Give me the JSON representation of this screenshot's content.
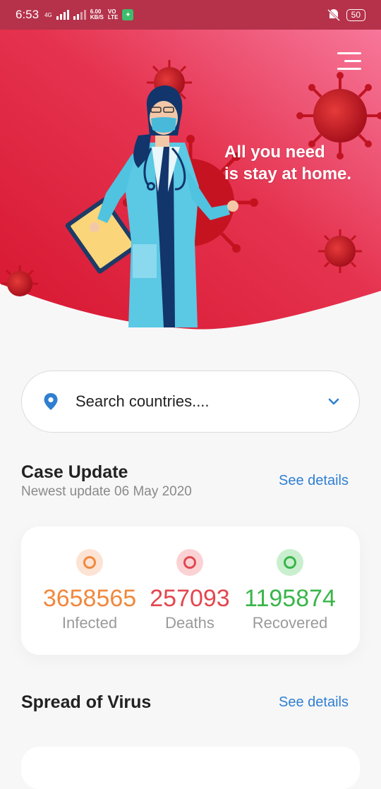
{
  "status_bar": {
    "time": "6:53",
    "network_4g": "4G",
    "speed_value": "6.00",
    "speed_unit": "KB/S",
    "volte_top": "VO",
    "volte_bottom": "LTE",
    "battery": "50"
  },
  "hero": {
    "headline_line1": "All you need",
    "headline_line2": "is stay at home."
  },
  "search": {
    "placeholder": "Search countries...."
  },
  "case_update": {
    "title": "Case Update",
    "subtitle": "Newest update 06 May 2020",
    "see_details": "See details"
  },
  "stats": [
    {
      "value": "3658565",
      "label": "Infected",
      "color": "#f0883e"
    },
    {
      "value": "257093",
      "label": "Deaths",
      "color": "#e2474f"
    },
    {
      "value": "1195874",
      "label": "Recovered",
      "color": "#39b54a"
    }
  ],
  "spread": {
    "title": "Spread of Virus",
    "see_details": "See details"
  },
  "colors": {
    "accent": "#2f7fd1",
    "hero_red": "#e0203a",
    "hero_pink": "#f4627e"
  }
}
